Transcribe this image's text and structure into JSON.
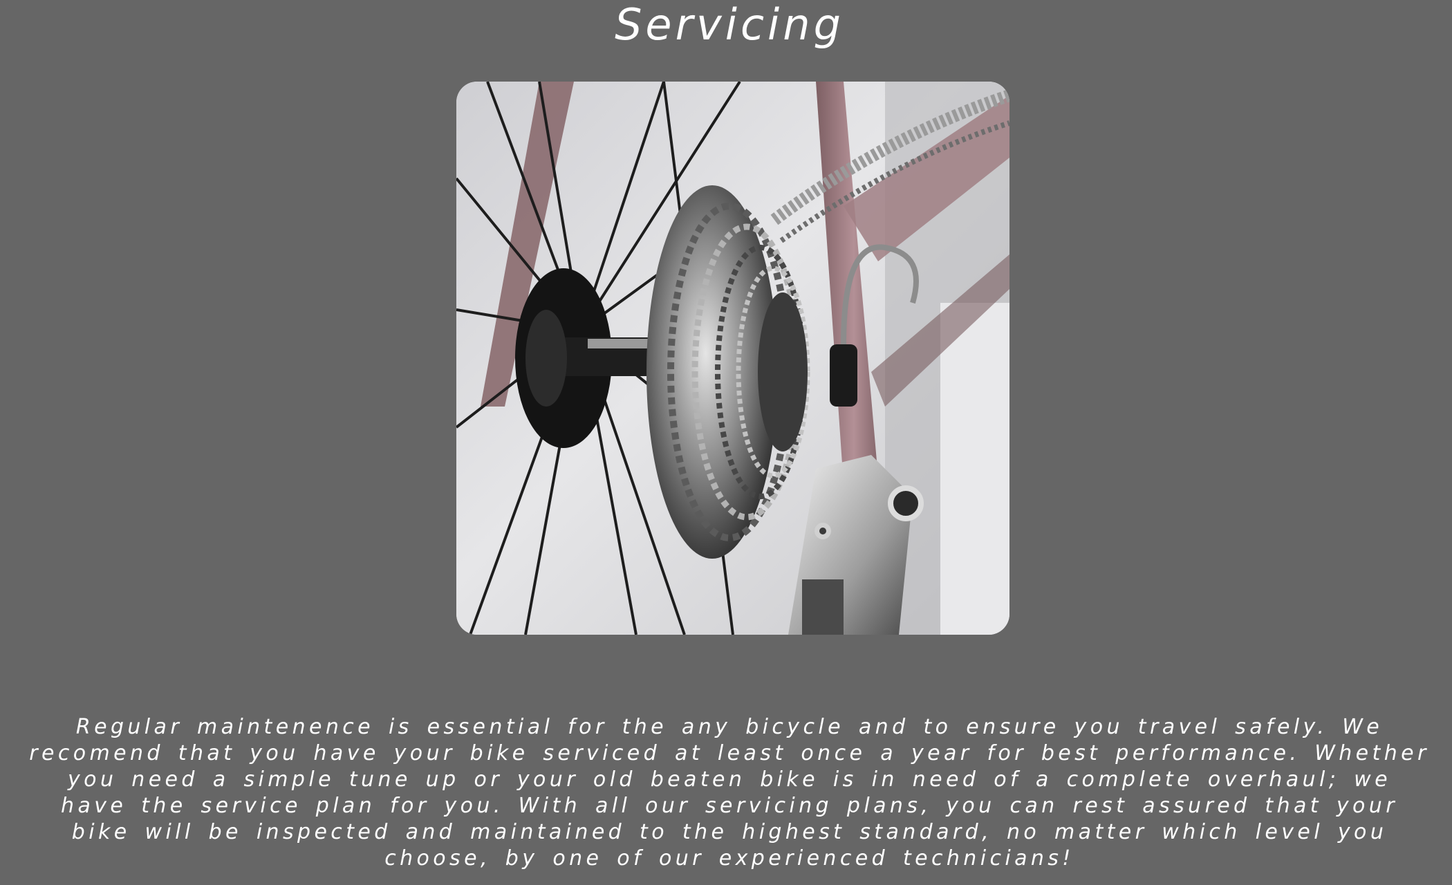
{
  "page": {
    "background": "#666666",
    "text_color": "#ffffff"
  },
  "servicing": {
    "title": "Servicing",
    "image_subject": "bicycle-rear-cassette-photo",
    "description": "Regular maintenence is essential for the any bicycle and to ensure you travel safely. We recomend that you have your bike serviced at least once a year for best performance. Whether you need a simple tune up or your old beaten bike is in need of a complete overhaul; we have the service plan for you. With all our servicing plans, you can rest assured that your bike will be inspected and maintained to the highest standard, no matter which level you choose, by one of our experienced technicians!"
  }
}
